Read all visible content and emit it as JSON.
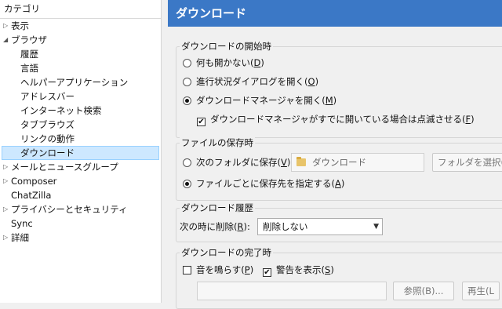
{
  "tree": {
    "title": "カテゴリ",
    "items": [
      {
        "label": "表示",
        "level": 0,
        "twisty": "closed"
      },
      {
        "label": "ブラウザ",
        "level": 0,
        "twisty": "open"
      },
      {
        "label": "履歴",
        "level": 1
      },
      {
        "label": "言語",
        "level": 1
      },
      {
        "label": "ヘルパーアプリケーション",
        "level": 1
      },
      {
        "label": "アドレスバー",
        "level": 1
      },
      {
        "label": "インターネット検索",
        "level": 1
      },
      {
        "label": "タブブラウズ",
        "level": 1
      },
      {
        "label": "リンクの動作",
        "level": 1
      },
      {
        "label": "ダウンロード",
        "level": 1,
        "selected": true
      },
      {
        "label": "メールとニュースグループ",
        "level": 0,
        "twisty": "closed"
      },
      {
        "label": "Composer",
        "level": 0,
        "twisty": "closed"
      },
      {
        "label": "ChatZilla",
        "level": 0
      },
      {
        "label": "プライバシーとセキュリティ",
        "level": 0,
        "twisty": "closed"
      },
      {
        "label": "Sync",
        "level": 0
      },
      {
        "label": "詳細",
        "level": 0,
        "twisty": "closed"
      }
    ]
  },
  "header": {
    "title": "ダウンロード",
    "color": "#3b78c6"
  },
  "start_group": {
    "title": "ダウンロードの開始時",
    "opt_nothing": "何も開かない(",
    "opt_nothing_key": "D",
    "opt_end": ")",
    "opt_progress": "進行状況ダイアログを開く(",
    "opt_progress_key": "O",
    "opt_manager": "ダウンロードマネージャを開く(",
    "opt_manager_key": "M",
    "flash_check": "ダウンロードマネージャがすでに開いている場合は点滅させる(",
    "flash_key": "F"
  },
  "save_group": {
    "title": "ファイルの保存時",
    "opt_folder": "次のフォルダに保存(",
    "opt_folder_key": "V",
    "folder_value": "ダウンロード",
    "choose_button": "フォルダを選択(C",
    "opt_ask": "ファイルごとに保存先を指定する(",
    "opt_ask_key": "A"
  },
  "history_group": {
    "title": "ダウンロード履歴",
    "remove_label": "次の時に削除(",
    "remove_key": "R",
    "remove_tail": "):",
    "remove_value": "削除しない"
  },
  "complete_group": {
    "title": "ダウンロードの完了時",
    "sound_label": "音を鳴らす(",
    "sound_key": "P",
    "alert_label": "警告を表示(",
    "alert_key": "S",
    "browse_button": "参照(B)...",
    "play_button": "再生(L"
  },
  "icons": {
    "checkmark": "✔",
    "arrow_down": "▼",
    "twisty_closed": "▷",
    "twisty_open": "◢"
  }
}
